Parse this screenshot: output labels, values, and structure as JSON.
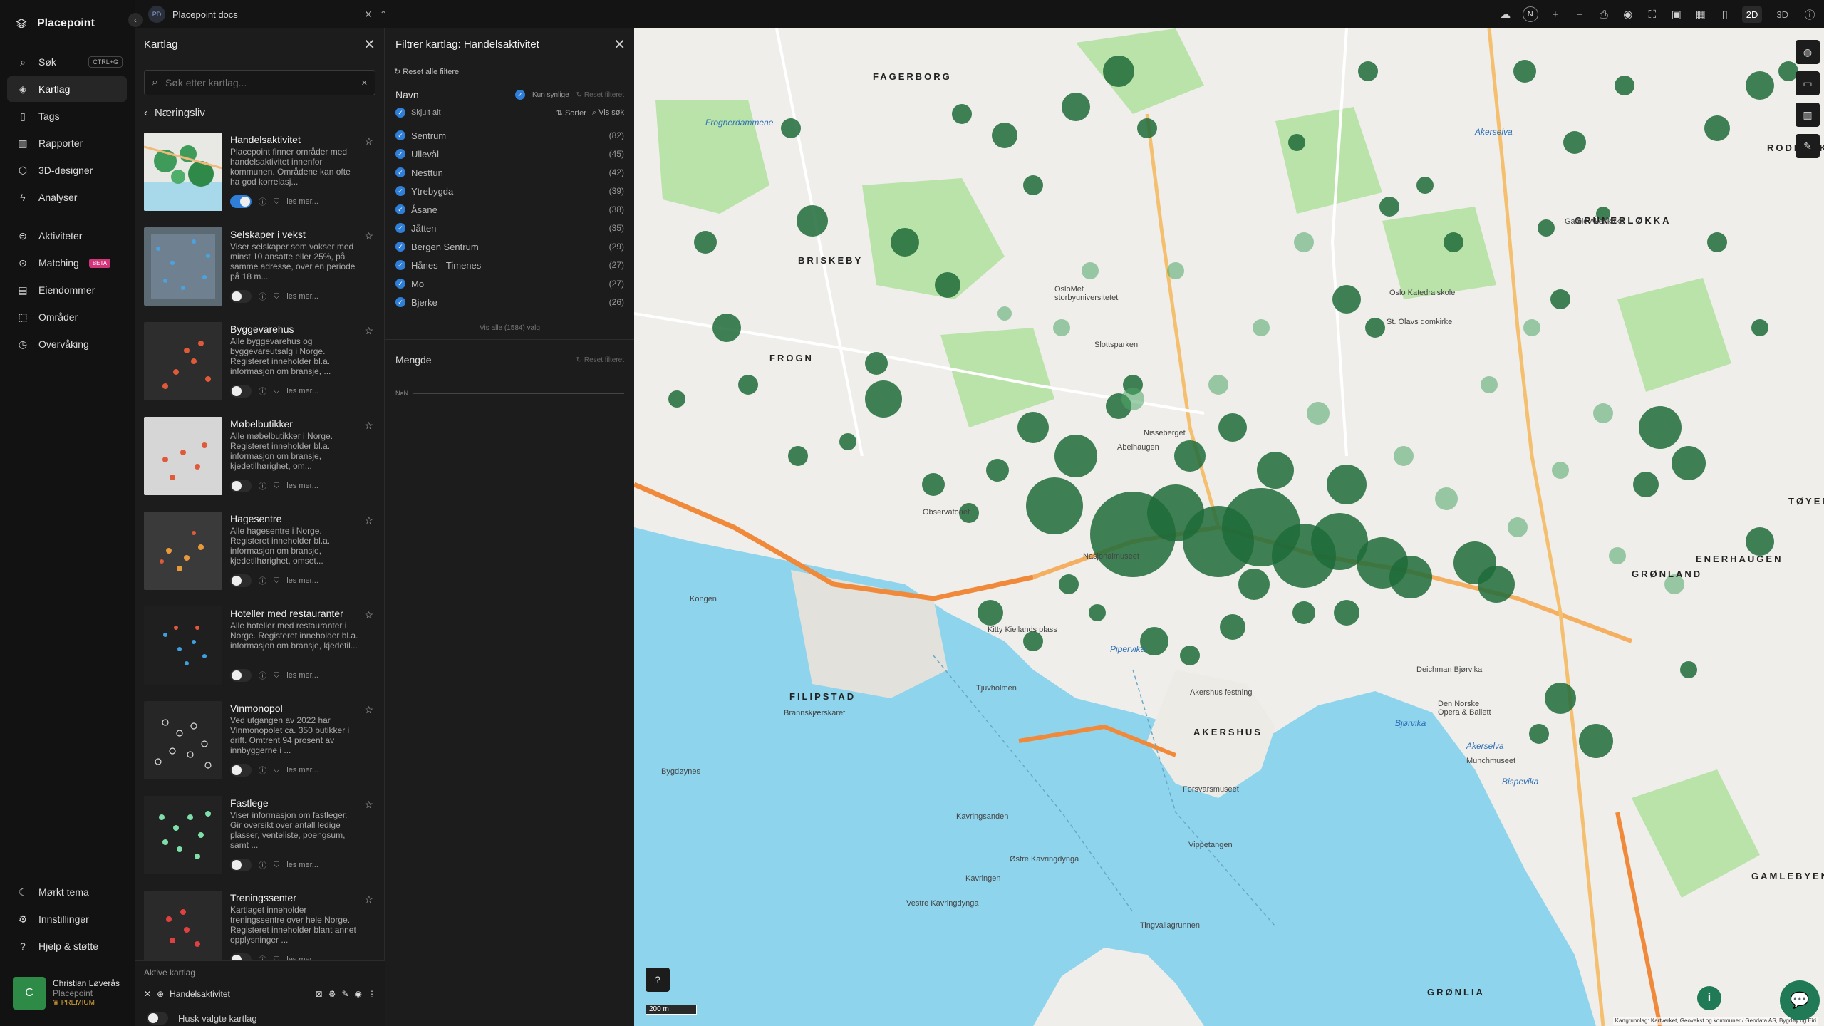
{
  "app": {
    "name": "Placepoint"
  },
  "nav": {
    "items": [
      {
        "label": "Søk",
        "shortcut": "CTRL+G"
      },
      {
        "label": "Kartlag"
      },
      {
        "label": "Tags"
      },
      {
        "label": "Rapporter"
      },
      {
        "label": "3D-designer"
      },
      {
        "label": "Analyser"
      },
      {
        "label": "Aktiviteter"
      },
      {
        "label": "Matching",
        "badge": "BETA"
      },
      {
        "label": "Eiendommer"
      },
      {
        "label": "Områder"
      },
      {
        "label": "Overvåking"
      }
    ],
    "bottom": [
      {
        "label": "Mørkt tema"
      },
      {
        "label": "Innstillinger"
      },
      {
        "label": "Hjelp & støtte"
      }
    ]
  },
  "user": {
    "initial": "C",
    "name": "Christian Løverås",
    "org": "Placepoint",
    "plan": "PREMIUM"
  },
  "topbar": {
    "doc_badge": "PD",
    "doc_title": "Placepoint docs",
    "mode_2d": "2D",
    "mode_3d": "3D",
    "north": "N"
  },
  "kartlag": {
    "title": "Kartlag",
    "search_placeholder": "Søk etter kartlag...",
    "breadcrumb": "Næringsliv",
    "read_more": "les mer...",
    "layers": [
      {
        "name": "Handelsaktivitet",
        "desc": "Placepoint finner områder med handelsaktivitet innenfor kommunen. Områdene kan ofte ha god korrelasj...",
        "on": true
      },
      {
        "name": "Selskaper i vekst",
        "desc": "Viser selskaper som vokser med minst 10 ansatte eller 25%, på samme adresse, over en periode på 18 m...",
        "on": false
      },
      {
        "name": "Byggevarehus",
        "desc": "Alle byggevarehus og byggevareutsalg i Norge. Registeret inneholder bl.a. informasjon om bransje, ...",
        "on": false
      },
      {
        "name": "Møbelbutikker",
        "desc": "Alle møbelbutikker i Norge. Registeret inneholder bl.a. informasjon om bransje, kjedetilhørighet, om...",
        "on": false
      },
      {
        "name": "Hagesentre",
        "desc": "Alle hagesentre i Norge. Registeret inneholder bl.a. informasjon om bransje, kjedetilhørighet, omset...",
        "on": false
      },
      {
        "name": "Hoteller med restauranter",
        "desc": "Alle hoteller med restauranter i Norge. Registeret inneholder bl.a. informasjon om bransje, kjedetil...",
        "on": false
      },
      {
        "name": "Vinmonopol",
        "desc": "Ved utgangen av 2022 har Vinmonopolet ca. 350 butikker i drift. Omtrent 94 prosent av innbyggerne i ...",
        "on": false
      },
      {
        "name": "Fastlege",
        "desc": "Viser informasjon om fastleger. Gir oversikt over antall ledige plasser, venteliste, poengsum, samt ...",
        "on": false
      },
      {
        "name": "Treningssenter",
        "desc": "Kartlaget inneholder treningssentre over hele Norge. Registeret inneholder blant annet opplysninger ...",
        "on": false
      }
    ],
    "active_title": "Aktive kartlag",
    "active_layer": "Handelsaktivitet",
    "remember": "Husk valgte kartlag"
  },
  "filter": {
    "title": "Filtrer kartlag: Handelsaktivitet",
    "reset_all": "Reset alle filtere",
    "section_name": "Navn",
    "only_visible": "Kun synlige",
    "reset_filter": "Reset filteret",
    "hide_all": "Skjult alt",
    "sort": "Sorter",
    "show_search": "Vis søk",
    "items": [
      {
        "name": "Sentrum",
        "count": "(82)"
      },
      {
        "name": "Ullevål",
        "count": "(45)"
      },
      {
        "name": "Nesttun",
        "count": "(42)"
      },
      {
        "name": "Ytrebygda",
        "count": "(39)"
      },
      {
        "name": "Åsane",
        "count": "(38)"
      },
      {
        "name": "Jåtten",
        "count": "(35)"
      },
      {
        "name": "Bergen Sentrum",
        "count": "(29)"
      },
      {
        "name": "Hånes - Timenes",
        "count": "(27)"
      },
      {
        "name": "Mo",
        "count": "(27)"
      },
      {
        "name": "Bjerke",
        "count": "(26)"
      }
    ],
    "see_all": "Vis alle (1584) valg",
    "section_amount": "Mengde",
    "reset_amount": "Reset filteret",
    "nan": "NaN"
  },
  "map": {
    "scale": "200 m",
    "attribution": "Kartgrunnlag: Kartverket, Geovekst og kommuner / Geodata AS, Bygdøy og Eiri",
    "cluster_color": "#1f6b3a",
    "labels": {
      "fagerborg": "FAGERBORG",
      "briskeby": "BRISKEBY",
      "frogner": "FROGN",
      "filipstad": "FILIPSTAD",
      "akershus": "AKERSHUS",
      "grunerlokka": "GRÜNERLØKKA",
      "toyen": "TØYEN",
      "enerhaugen": "ENERHAUGEN",
      "gronland": "GRØNLAND",
      "gamlebyen": "GAMLEBYEN",
      "gronlia": "GRØNLIA",
      "rodelokka": "RODELØKKA",
      "frognerdammene": "Frognerdammene",
      "akerselva": "Akerselva",
      "akerselva2": "Akerselva",
      "pipervika": "Pipervika",
      "bjorvika": "Bjørvika",
      "bispevika": "Bispevika",
      "kongen": "Kongen",
      "tjuvholmen": "Tjuvholmen",
      "kavringen": "Kavringen",
      "ostre": "Østre Kavringdynga",
      "vestre": "Vestre Kavringdynga",
      "kavringsanden": "Kavringsanden",
      "tingvallagrunnen": "Tingvallagrunnen",
      "nisseberget": "Nisseberget",
      "abelhaugen": "Abelhaugen",
      "observatoriet": "Observatoriet",
      "nasjonalmuseet": "Nasjonalmuseet",
      "oslomet": "OsloMet storbyuniversitetet",
      "slottsparken": "Slottsparken",
      "deichman": "Deichman Bjørvika",
      "operaen": "Den Norske Opera & Ballett",
      "munchmuseet": "Munchmuseet",
      "forsvarsmuseet": "Forsvarsmuseet",
      "akershus_festning": "Akershus festning",
      "brannskjaerskaret": "Brannskjærskaret",
      "bygdoynes": "Bygdøynes",
      "vippetangen": "Vippetangen",
      "kitty": "Kitty Kiellands plass",
      "oslo_kat": "Oslo Katedralskole",
      "st_olavs": "St. Olavs domkirke",
      "gamle_aker": "Gamle Aker kirke"
    }
  }
}
